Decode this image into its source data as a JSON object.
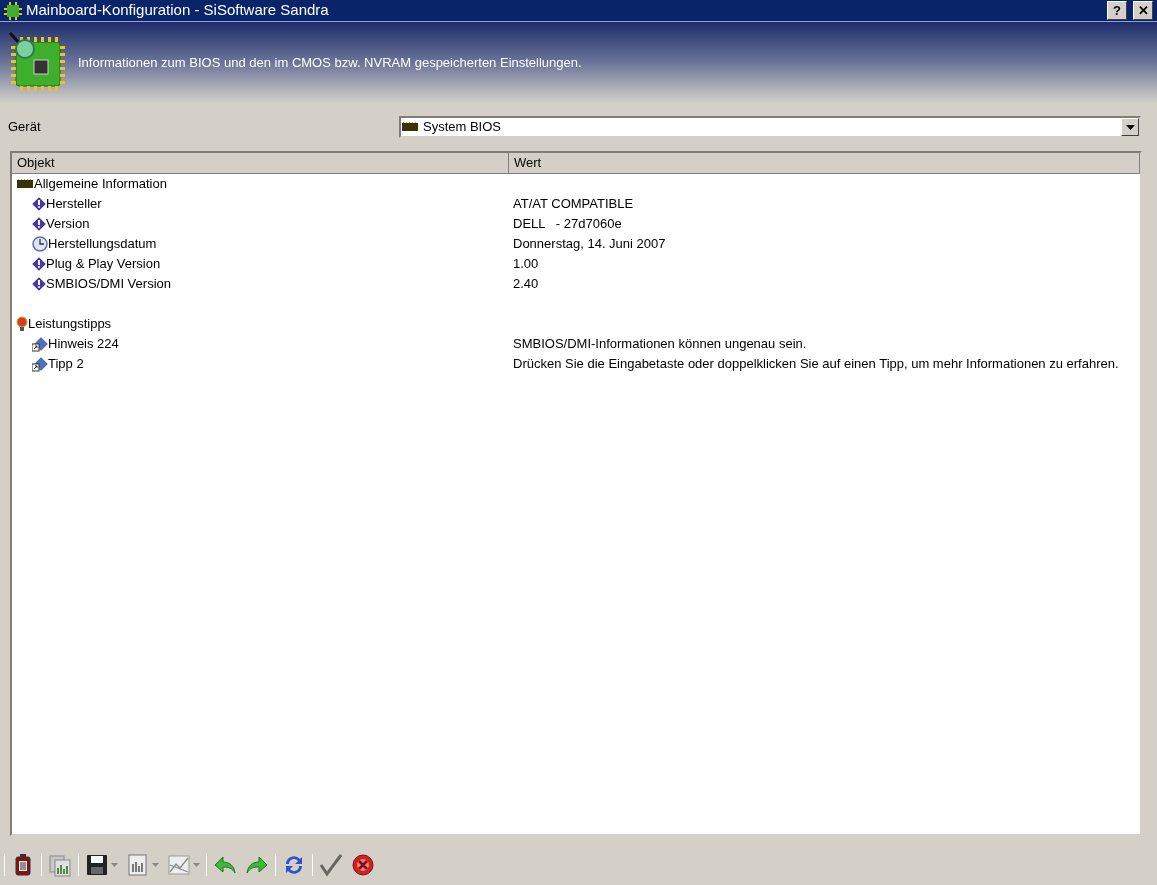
{
  "window": {
    "title": "Mainboard-Konfiguration - SiSoftware Sandra",
    "buttons": [
      {
        "kind": "help",
        "label": "?"
      },
      {
        "kind": "close",
        "label": "✕"
      }
    ]
  },
  "header": {
    "description": "Informationen zum BIOS und den im CMOS bzw. NVRAM gespeicherten Einstellungen."
  },
  "device": {
    "label": "Gerät",
    "value": "System BIOS"
  },
  "table": {
    "columns": [
      "Objekt",
      "Wert"
    ],
    "rows": [
      {
        "kind": "chip-group",
        "object": "Allgemeine Information",
        "value": ""
      },
      {
        "kind": "info",
        "object": "Hersteller",
        "value": "AT/AT COMPATIBLE"
      },
      {
        "kind": "info",
        "object": "Version",
        "value": "DELL   - 27d7060e"
      },
      {
        "kind": "clock",
        "object": "Herstellungsdatum",
        "value": "Donnerstag, 14. Juni 2007"
      },
      {
        "kind": "info",
        "object": "Plug & Play Version",
        "value": "1.00"
      },
      {
        "kind": "info",
        "object": "SMBIOS/DMI Version",
        "value": "2.40"
      },
      {
        "kind": "blank",
        "object": "",
        "value": ""
      },
      {
        "kind": "tip-group",
        "object": "Leistungstipps",
        "value": ""
      },
      {
        "kind": "tip",
        "object": "Hinweis 224",
        "value": "SMBIOS/DMI-Informationen können ungenau sein."
      },
      {
        "kind": "tip",
        "object": "Tipp 2",
        "value": "Drücken Sie die Eingabetaste oder doppelklicken Sie auf einen Tipp, um mehr Informationen zu erfahren."
      }
    ]
  },
  "toolbar": [
    {
      "kind": "module"
    },
    {
      "kind": "compare"
    },
    {
      "kind": "save"
    },
    {
      "kind": "menu-arrow"
    },
    {
      "kind": "report"
    },
    {
      "kind": "menu-arrow"
    },
    {
      "kind": "graph"
    },
    {
      "kind": "menu-arrow"
    },
    {
      "kind": "back"
    },
    {
      "kind": "forward"
    },
    {
      "kind": "refresh"
    },
    {
      "kind": "ok"
    },
    {
      "kind": "cancel"
    }
  ]
}
